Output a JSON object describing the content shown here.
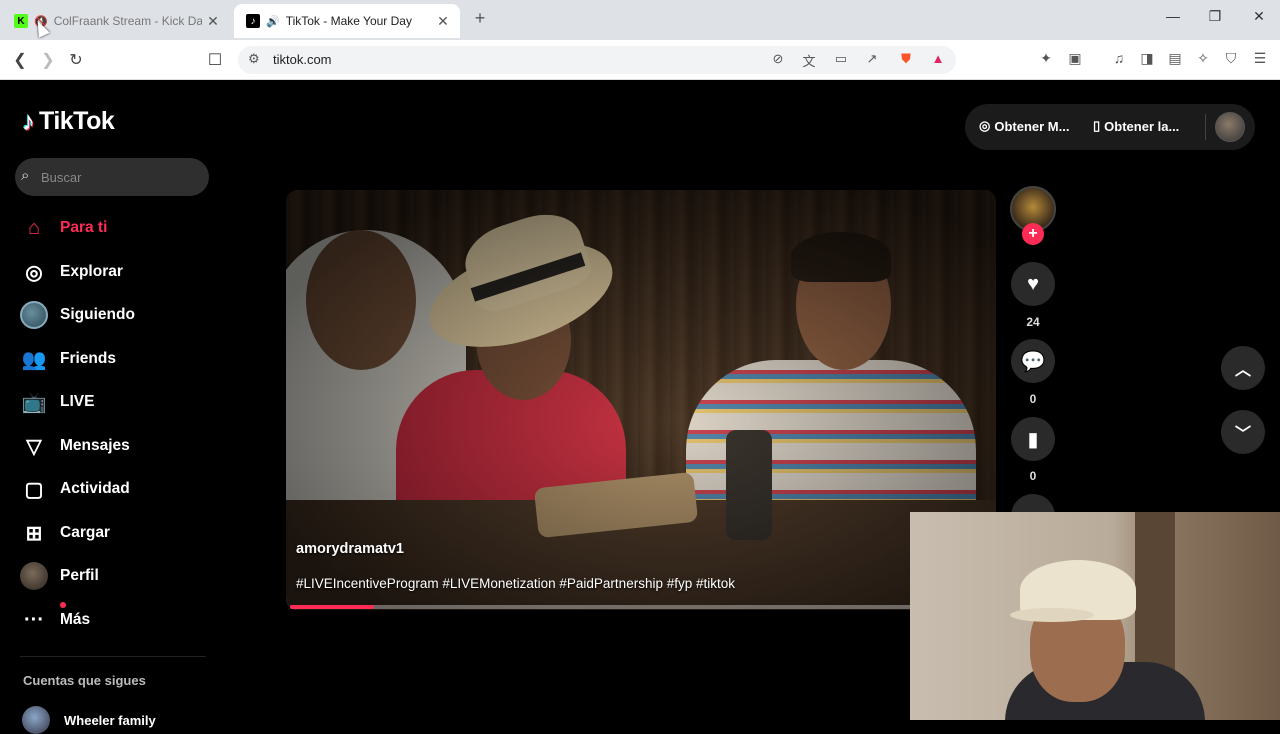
{
  "browser": {
    "tabs": [
      {
        "title": "ColFraank Stream - Kick Dash",
        "favicon": "kick-icon"
      },
      {
        "title": "TikTok - Make Your Day",
        "favicon": "tiktok-icon"
      }
    ],
    "url": "tiktok.com"
  },
  "logo": {
    "text": "TikTok"
  },
  "search": {
    "placeholder": "Buscar"
  },
  "sidebar": {
    "items": [
      {
        "label": "Para ti",
        "icon": "home-icon"
      },
      {
        "label": "Explorar",
        "icon": "compass-icon"
      },
      {
        "label": "Siguiendo",
        "icon": "avatar"
      },
      {
        "label": "Friends",
        "icon": "friends-icon"
      },
      {
        "label": "LIVE",
        "icon": "live-icon"
      },
      {
        "label": "Mensajes",
        "icon": "send-icon"
      },
      {
        "label": "Actividad",
        "icon": "activity-icon"
      },
      {
        "label": "Cargar",
        "icon": "upload-icon"
      },
      {
        "label": "Perfil",
        "icon": "avatar"
      },
      {
        "label": "Más",
        "icon": "more-icon"
      }
    ],
    "following_heading": "Cuentas que sigues",
    "following_accounts": [
      "Wheeler family"
    ]
  },
  "top_actions": {
    "get_app": "Obtener M...",
    "get_desktop": "Obtener la..."
  },
  "video": {
    "author": "amorydramatv1",
    "caption": "#LIVEIncentiveProgram #LIVEMonetization #PaidPartnership #fyp #tiktok",
    "progress": 0.12
  },
  "actions": {
    "likes": "24",
    "comments": "0",
    "saves": "0"
  },
  "colors": {
    "accent": "#fe2c55",
    "background": "#000000"
  }
}
